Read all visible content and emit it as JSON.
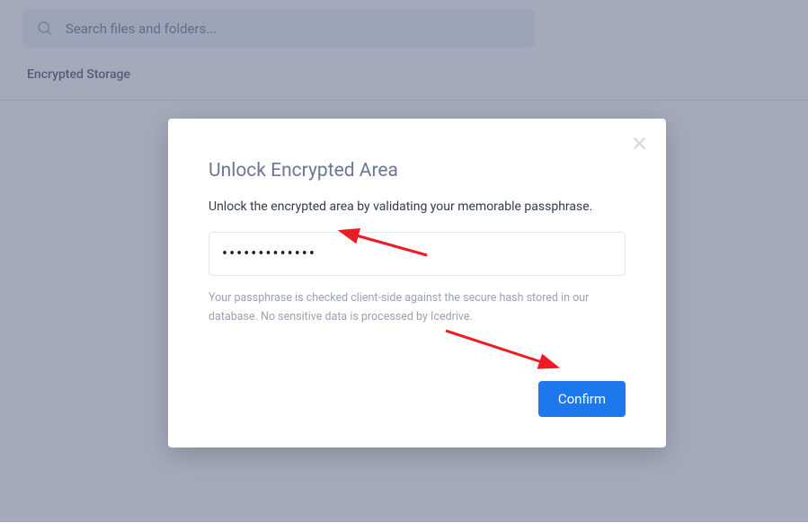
{
  "search": {
    "placeholder": "Search files and folders..."
  },
  "page": {
    "title": "Encrypted Storage"
  },
  "dialog": {
    "title": "Unlock Encrypted Area",
    "subtitle": "Unlock the encrypted area by validating your memorable passphrase.",
    "passphrase_value": "•••••••••••••",
    "hint": "Your passphrase is checked client-side against the secure hash stored in our database. No sensitive data is processed by Icedrive.",
    "confirm_label": "Confirm"
  }
}
